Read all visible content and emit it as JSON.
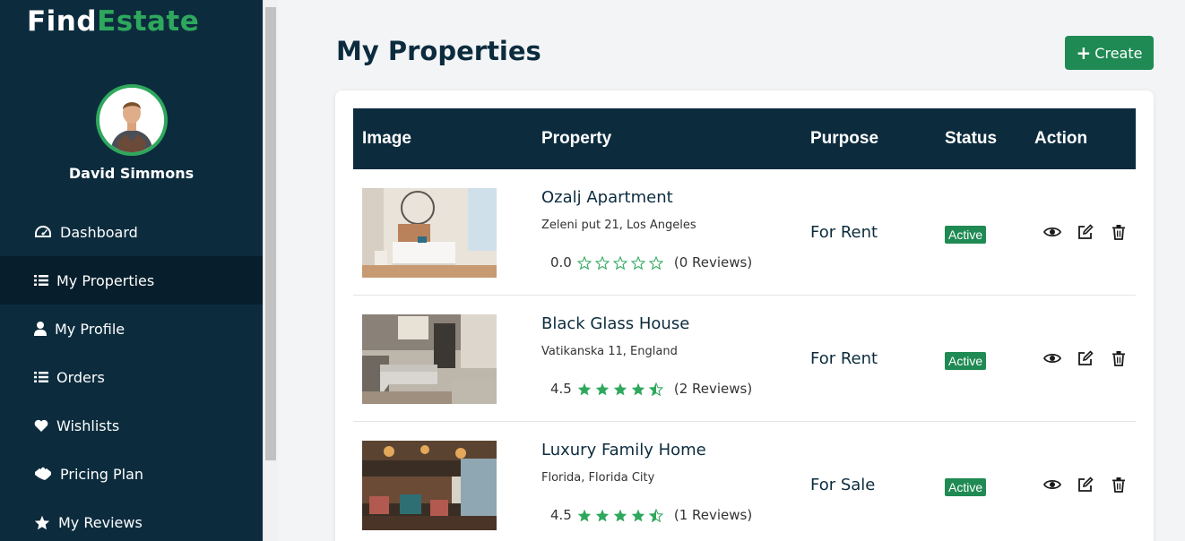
{
  "app": {
    "logo_part1": "Find",
    "logo_part2": "Estate",
    "accent": "#2ea85c",
    "sidebar_bg": "#0c2c3e"
  },
  "user": {
    "name": "David Simmons"
  },
  "sidebar": {
    "items": [
      {
        "label": "Dashboard",
        "icon": "gauge-icon",
        "active": false
      },
      {
        "label": "My Properties",
        "icon": "list-icon",
        "active": true
      },
      {
        "label": "My Profile",
        "icon": "user-icon",
        "active": false
      },
      {
        "label": "Orders",
        "icon": "list-icon",
        "active": false
      },
      {
        "label": "Wishlists",
        "icon": "heart-icon",
        "active": false
      },
      {
        "label": "Pricing Plan",
        "icon": "handshake-icon",
        "active": false
      },
      {
        "label": "My Reviews",
        "icon": "star-icon",
        "active": false
      }
    ]
  },
  "page": {
    "title": "My Properties",
    "create_label": "Create"
  },
  "table": {
    "headers": {
      "image": "Image",
      "property": "Property",
      "purpose": "Purpose",
      "status": "Status",
      "action": "Action"
    },
    "rows": [
      {
        "name": "Ozalj Apartment",
        "address": "Zeleni put 21, Los Angeles",
        "rating": "0.0",
        "stars": 0,
        "reviews": "(0 Reviews)",
        "purpose": "For Rent",
        "status": "Active"
      },
      {
        "name": "Black Glass House",
        "address": "Vatikanska 11, England",
        "rating": "4.5",
        "stars": 4.5,
        "reviews": "(2 Reviews)",
        "purpose": "For Rent",
        "status": "Active"
      },
      {
        "name": "Luxury Family Home",
        "address": "Florida, Florida City",
        "rating": "4.5",
        "stars": 4.5,
        "reviews": "(1 Reviews)",
        "purpose": "For Sale",
        "status": "Active"
      }
    ]
  }
}
